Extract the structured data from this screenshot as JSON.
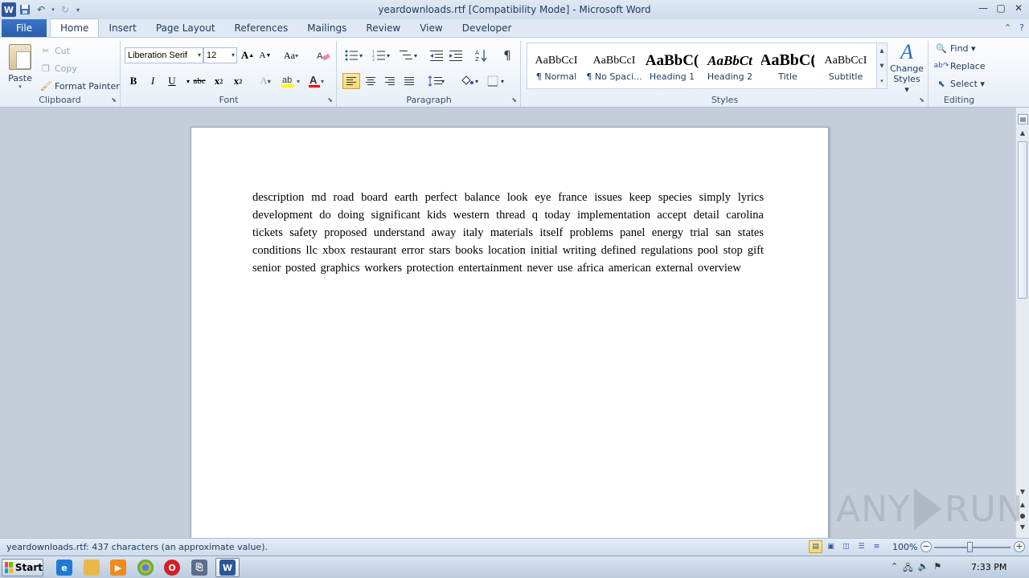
{
  "window": {
    "title": "yeardownloads.rtf [Compatibility Mode]  -  Microsoft Word",
    "app_logo": "W"
  },
  "tabs": [
    "File",
    "Home",
    "Insert",
    "Page Layout",
    "References",
    "Mailings",
    "Review",
    "View",
    "Developer"
  ],
  "active_tab": "Home",
  "ribbon": {
    "clipboard": {
      "label": "Clipboard",
      "paste": "Paste",
      "cut": "Cut",
      "copy": "Copy",
      "format_painter": "Format Painter"
    },
    "font": {
      "label": "Font",
      "font_name": "Liberation Serif",
      "font_size": "12",
      "bold": "B",
      "italic": "I",
      "underline": "U",
      "strike": "abc",
      "grow": "A",
      "shrink": "A",
      "change_case": "Aa",
      "highlight_color": "#ffff00",
      "font_color": "#ff0000"
    },
    "paragraph": {
      "label": "Paragraph",
      "show_marks": "¶"
    },
    "styles": {
      "label": "Styles",
      "items": [
        {
          "sample": "AaBbCcI",
          "name": "¶ Normal"
        },
        {
          "sample": "AaBbCcI",
          "name": "¶ No Spaci..."
        },
        {
          "sample": "AaBbC(",
          "name": "Heading 1"
        },
        {
          "sample": "AaBbCt",
          "name": "Heading 2"
        },
        {
          "sample": "AaBbC(",
          "name": "Title"
        },
        {
          "sample": "AaBbCcI",
          "name": "Subtitle"
        }
      ],
      "change_styles_line1": "Change",
      "change_styles_line2": "Styles ▾"
    },
    "editing": {
      "label": "Editing",
      "find": "Find ▾",
      "replace": "Replace",
      "select": "Select ▾"
    }
  },
  "document": {
    "text": "description  md  road board earth  perfect  balance  look    eye france  issues  keep    species  simply  lyrics development  do doing    significant    kids western    thread  q today implementation      accept detail carolina  tickets safety      proposed   understand   away    italy  materials  itself  problems  panel  energy trial    san states  conditions  llc  xbox      restaurant  error stars books location  initial  writing  defined regulations  pool  stop gift  senior  posted graphics  workers protection  entertainment  never    use africa american      external  overview"
  },
  "statusbar": {
    "text": "yeardownloads.rtf: 437 characters (an approximate value).",
    "zoom": "100%",
    "zoom_fraction": 0.47
  },
  "taskbar": {
    "start": "Start",
    "clock": "7:33 PM"
  },
  "watermark": {
    "left": "ANY",
    "right": "RUN"
  },
  "colors": {
    "file_tab": "#2a5ea8",
    "accent": "#2b579a"
  }
}
